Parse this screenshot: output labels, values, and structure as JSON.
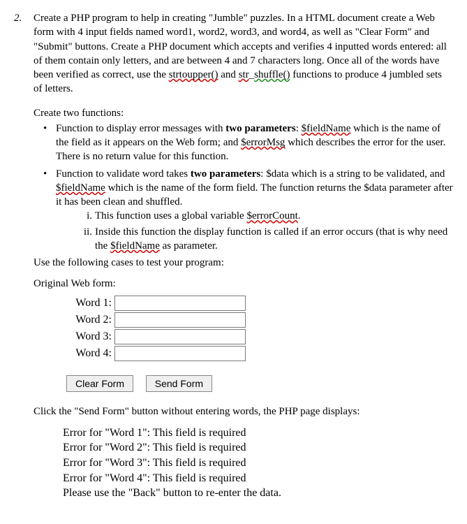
{
  "question_number": "2.",
  "intro_segments": {
    "s1": "Create a PHP program to help in creating \"Jumble\" puzzles. In a HTML document create a Web form with 4 input fields named word1, word2, word3, and word4, as well as \"Clear Form\" and \"Submit\" buttons. Create a PHP document which accepts and verifies 4 inputted words entered: all of them contain only letters, and are between 4 and 7 characters long. Once all of the words have been verified as correct, use the ",
    "fn1": "strtoupper()",
    "s2": " and ",
    "fn2a": "str",
    "fn2b": "shuffle()",
    "s3": " functions to produce 4 jumbled sets of letters."
  },
  "create_two": "Create two functions:",
  "bullet1": {
    "a": "Function to display error messages with ",
    "b": "two parameters",
    "c": ": ",
    "d": "$fieldName",
    "e": " which is the name of the field as it appears on the Web form; and ",
    "f": "$errorMsg",
    "g": " which describes the error for the user. There is no return value for this function."
  },
  "bullet2": {
    "a": "Function to validate word takes ",
    "b": "two parameters",
    "c": ": $data which is a string to be validated, and ",
    "d": "$fieldName",
    "e": " which is the name of the form field. The function returns the $data parameter after it has been clean and shuffled."
  },
  "roman1": {
    "num": "i.",
    "a": "This function uses a global variable ",
    "b": "$errorCount",
    "c": "."
  },
  "roman2": {
    "num": "ii.",
    "a": "Inside this function the display function is called if an error occurs (that is why need the ",
    "b": "$fieldName",
    "c": " as parameter."
  },
  "use_cases": "Use the following cases to test your program:",
  "orig_form": "Original Web form:",
  "form": {
    "w1": "Word 1:",
    "w2": "Word 2:",
    "w3": "Word 3:",
    "w4": "Word 4:",
    "clear": "Clear Form",
    "send": "Send Form"
  },
  "click_send": "Click the \"Send Form\" button without entering words, the PHP page displays:",
  "errors": {
    "e1": "Error for \"Word 1\": This field is required",
    "e2": "Error for \"Word 2\": This field is required",
    "e3": "Error for \"Word 3\": This field is required",
    "e4": "Error for \"Word 4\": This field is required",
    "back": "Please use the \"Back\" button to re-enter the data."
  }
}
